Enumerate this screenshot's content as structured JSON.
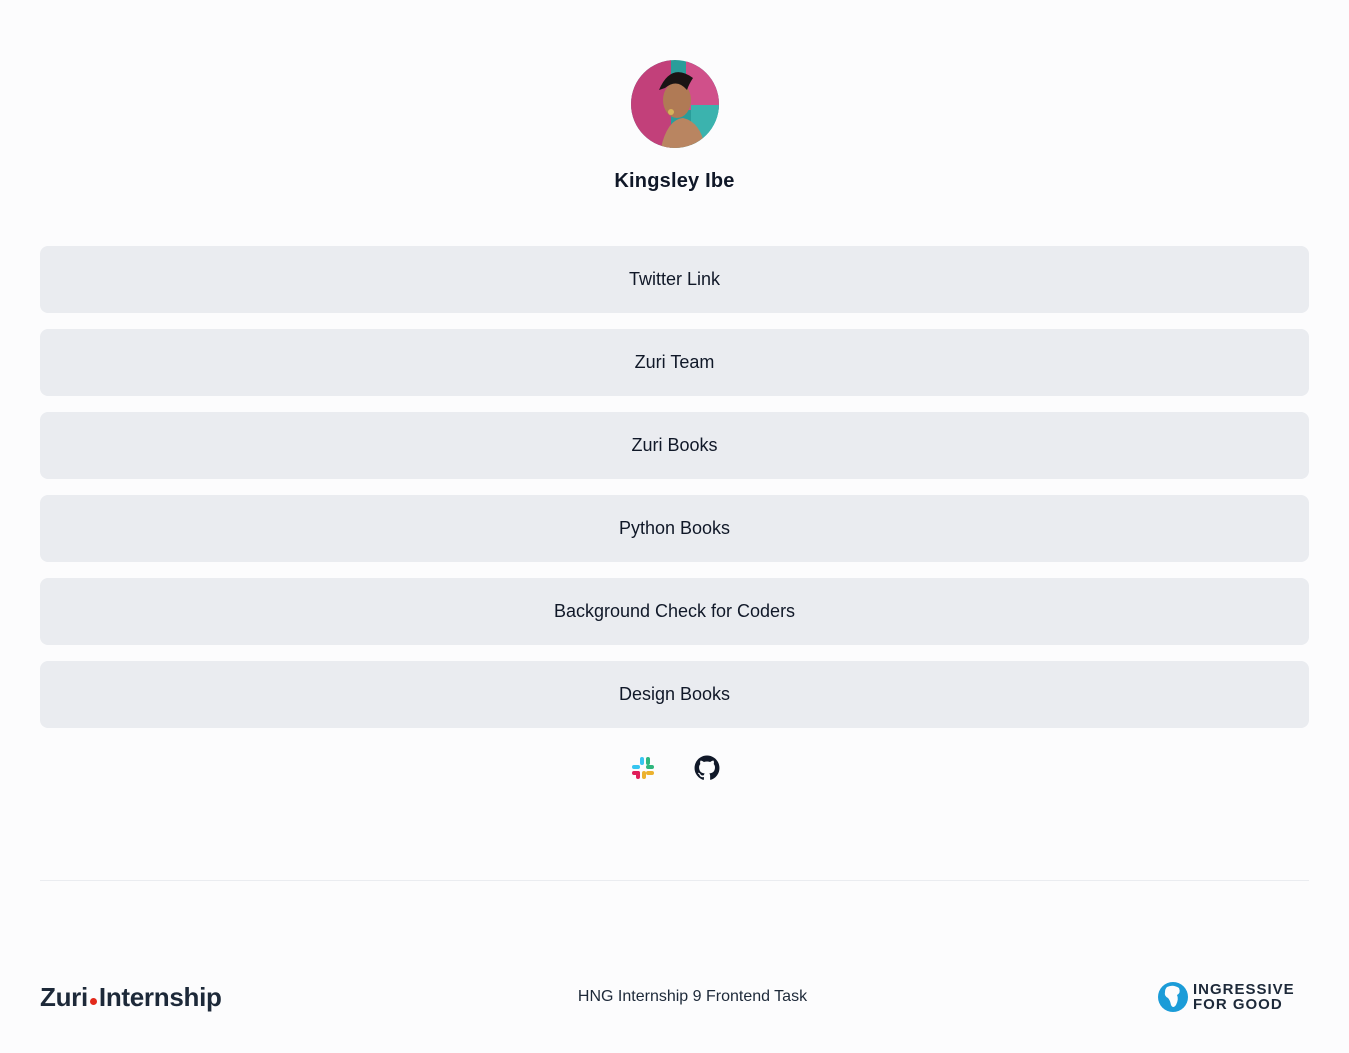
{
  "profile": {
    "name": "Kingsley Ibe",
    "avatar_icon": "profile-photo"
  },
  "links": [
    {
      "label": "Twitter Link"
    },
    {
      "label": "Zuri Team"
    },
    {
      "label": "Zuri Books"
    },
    {
      "label": "Python Books"
    },
    {
      "label": "Background Check for Coders"
    },
    {
      "label": "Design Books"
    }
  ],
  "socials": {
    "slack_icon": "slack-icon",
    "github_icon": "github-icon"
  },
  "footer": {
    "zuri_brand": "Zuri",
    "zuri_product": "Internship",
    "task_text": "HNG Internship 9 Frontend Task",
    "i4g_line1": "INGRESSIVE",
    "i4g_line2": "FOR GOOD"
  },
  "colors": {
    "button_bg": "#eaecf0",
    "text": "#101828",
    "zuri_dot": "#e2291b",
    "i4g_blue": "#1b9cd8"
  }
}
